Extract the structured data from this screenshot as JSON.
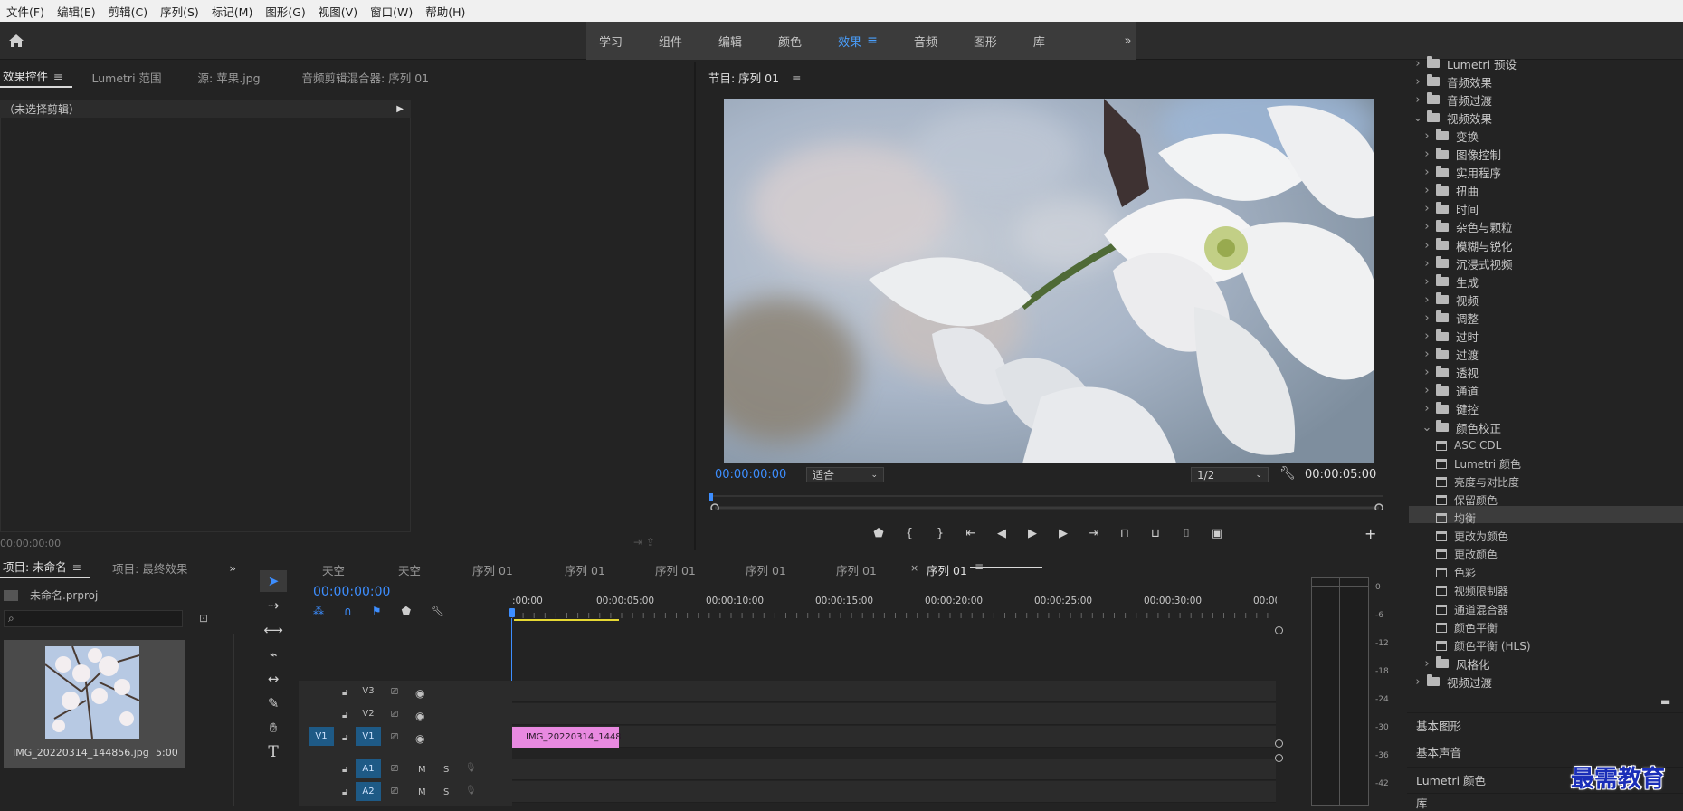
{
  "menubar": [
    "文件(F)",
    "编辑(E)",
    "剪辑(C)",
    "序列(S)",
    "标记(M)",
    "图形(G)",
    "视图(V)",
    "窗口(W)",
    "帮助(H)"
  ],
  "workspaces": {
    "tabs": [
      "学习",
      "组件",
      "编辑",
      "颜色",
      "效果",
      "音频",
      "图形",
      "库"
    ],
    "active": "效果"
  },
  "effect_panel": {
    "tabs": [
      "效果控件",
      "Lumetri 范围",
      "源: 苹果.jpg",
      "音频剪辑混合器: 序列 01"
    ],
    "no_selection": "（未选择剪辑）",
    "timecode": "00:00:00:00"
  },
  "program": {
    "title": "节目: 序列 01",
    "timecode": "00:00:00:00",
    "fit": "适合",
    "resolution": "1/2",
    "duration": "00:00:05:00"
  },
  "effects_tree": [
    {
      "label": "Lumetri 预设",
      "level": 0,
      "type": "folder",
      "expanded": false
    },
    {
      "label": "音频效果",
      "level": 0,
      "type": "folder",
      "expanded": false
    },
    {
      "label": "音频过渡",
      "level": 0,
      "type": "folder",
      "expanded": false
    },
    {
      "label": "视频效果",
      "level": 0,
      "type": "folder",
      "expanded": true
    },
    {
      "label": "变换",
      "level": 1,
      "type": "folder",
      "expanded": false
    },
    {
      "label": "图像控制",
      "level": 1,
      "type": "folder",
      "expanded": false
    },
    {
      "label": "实用程序",
      "level": 1,
      "type": "folder",
      "expanded": false
    },
    {
      "label": "扭曲",
      "level": 1,
      "type": "folder",
      "expanded": false
    },
    {
      "label": "时间",
      "level": 1,
      "type": "folder",
      "expanded": false
    },
    {
      "label": "杂色与颗粒",
      "level": 1,
      "type": "folder",
      "expanded": false
    },
    {
      "label": "模糊与锐化",
      "level": 1,
      "type": "folder",
      "expanded": false
    },
    {
      "label": "沉浸式视频",
      "level": 1,
      "type": "folder",
      "expanded": false
    },
    {
      "label": "生成",
      "level": 1,
      "type": "folder",
      "expanded": false
    },
    {
      "label": "视频",
      "level": 1,
      "type": "folder",
      "expanded": false
    },
    {
      "label": "调整",
      "level": 1,
      "type": "folder",
      "expanded": false
    },
    {
      "label": "过时",
      "level": 1,
      "type": "folder",
      "expanded": false
    },
    {
      "label": "过渡",
      "level": 1,
      "type": "folder",
      "expanded": false
    },
    {
      "label": "透视",
      "level": 1,
      "type": "folder",
      "expanded": false
    },
    {
      "label": "通道",
      "level": 1,
      "type": "folder",
      "expanded": false
    },
    {
      "label": "键控",
      "level": 1,
      "type": "folder",
      "expanded": false
    },
    {
      "label": "颜色校正",
      "level": 1,
      "type": "folder",
      "expanded": true
    },
    {
      "label": "ASC CDL",
      "level": 2,
      "type": "effect"
    },
    {
      "label": "Lumetri 颜色",
      "level": 2,
      "type": "effect"
    },
    {
      "label": "亮度与对比度",
      "level": 2,
      "type": "effect"
    },
    {
      "label": "保留颜色",
      "level": 2,
      "type": "effect"
    },
    {
      "label": "均衡",
      "level": 2,
      "type": "effect",
      "selected": true
    },
    {
      "label": "更改为颜色",
      "level": 2,
      "type": "effect"
    },
    {
      "label": "更改颜色",
      "level": 2,
      "type": "effect"
    },
    {
      "label": "色彩",
      "level": 2,
      "type": "effect"
    },
    {
      "label": "视频限制器",
      "level": 2,
      "type": "effect"
    },
    {
      "label": "通道混合器",
      "level": 2,
      "type": "effect"
    },
    {
      "label": "颜色平衡",
      "level": 2,
      "type": "effect"
    },
    {
      "label": "颜色平衡 (HLS)",
      "level": 2,
      "type": "effect"
    },
    {
      "label": "风格化",
      "level": 1,
      "type": "folder",
      "expanded": false
    },
    {
      "label": "视频过渡",
      "level": 0,
      "type": "folder",
      "expanded": false
    }
  ],
  "lower_panels": [
    "基本图形",
    "基本声音",
    "Lumetri 颜色",
    "库"
  ],
  "project": {
    "tabs": [
      "项目: 未命名",
      "项目: 最终效果"
    ],
    "file": "未命名.prproj",
    "clip_name": "IMG_20220314_144856.jpg",
    "clip_duration": "5:00"
  },
  "timeline": {
    "tabs": [
      "天空",
      "天空",
      "序列 01",
      "序列 01",
      "序列 01",
      "序列 01",
      "序列 01",
      "序列 01"
    ],
    "timecode": "00:00:00:00",
    "ruler": [
      ":00:00",
      "00:00:05:00",
      "00:00:10:00",
      "00:00:15:00",
      "00:00:20:00",
      "00:00:25:00",
      "00:00:30:00",
      "00:00"
    ],
    "video_tracks": [
      "V3",
      "V2",
      "V1"
    ],
    "audio_tracks": [
      "A1",
      "A2"
    ],
    "source_patch_v": "V1",
    "clip_label": "IMG_20220314_1448",
    "m": "M",
    "s": "S"
  },
  "meter_scale": [
    "0",
    "-6",
    "-12",
    "-18",
    "-24",
    "-30",
    "-36",
    "-42"
  ],
  "watermark": "最需教育",
  "colors": {
    "accent": "#3d8eff",
    "clip": "#e889e0",
    "track_select": "#1e5a86"
  }
}
